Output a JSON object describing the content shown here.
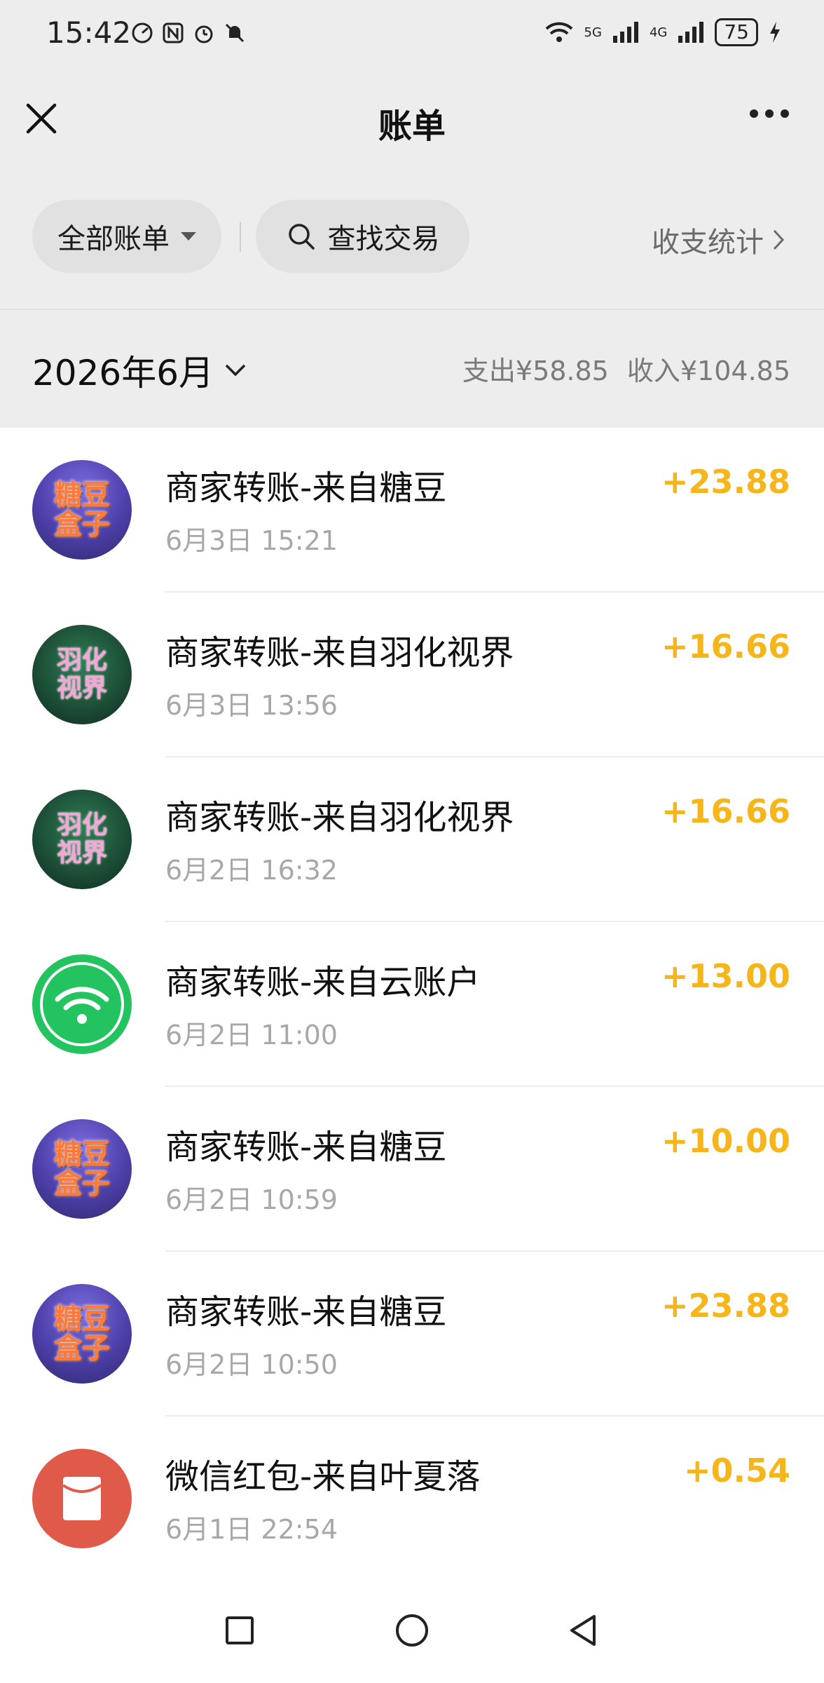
{
  "status_bar": {
    "time": "15:42",
    "battery": "75",
    "net_5g": "5G",
    "net_4g": "4G"
  },
  "header": {
    "title": "账单"
  },
  "filters": {
    "all_bills": "全部账单",
    "search": "查找交易",
    "stats": "收支统计"
  },
  "month": {
    "label": "2026年6月",
    "expense": "支出¥58.85",
    "income": "收入¥104.85"
  },
  "transactions": [
    {
      "title": "商家转账-来自糖豆",
      "time": "6月3日 15:21",
      "amount": "+23.88",
      "avatar": "candy",
      "avatar_text": [
        "糖豆",
        "盒子"
      ]
    },
    {
      "title": "商家转账-来自羽化视界",
      "time": "6月3日 13:56",
      "amount": "+16.66",
      "avatar": "yuhua",
      "avatar_text": [
        "羽化",
        "视界"
      ]
    },
    {
      "title": "商家转账-来自羽化视界",
      "time": "6月2日 16:32",
      "amount": "+16.66",
      "avatar": "yuhua",
      "avatar_text": [
        "羽化",
        "视界"
      ]
    },
    {
      "title": "商家转账-来自云账户",
      "time": "6月2日 11:00",
      "amount": "+13.00",
      "avatar": "wifi-icon"
    },
    {
      "title": "商家转账-来自糖豆",
      "time": "6月2日 10:59",
      "amount": "+10.00",
      "avatar": "candy",
      "avatar_text": [
        "糖豆",
        "盒子"
      ]
    },
    {
      "title": "商家转账-来自糖豆",
      "time": "6月2日 10:50",
      "amount": "+23.88",
      "avatar": "candy",
      "avatar_text": [
        "糖豆",
        "盒子"
      ]
    },
    {
      "title": "微信红包-来自叶夏落",
      "time": "6月1日 22:54",
      "amount": "+0.54",
      "avatar": "red-packet-icon"
    }
  ],
  "colors": {
    "income_amount": "#f6b619",
    "background": "#ededed",
    "wifi_avatar": "#23c35f",
    "red_packet": "#e05a4a"
  }
}
